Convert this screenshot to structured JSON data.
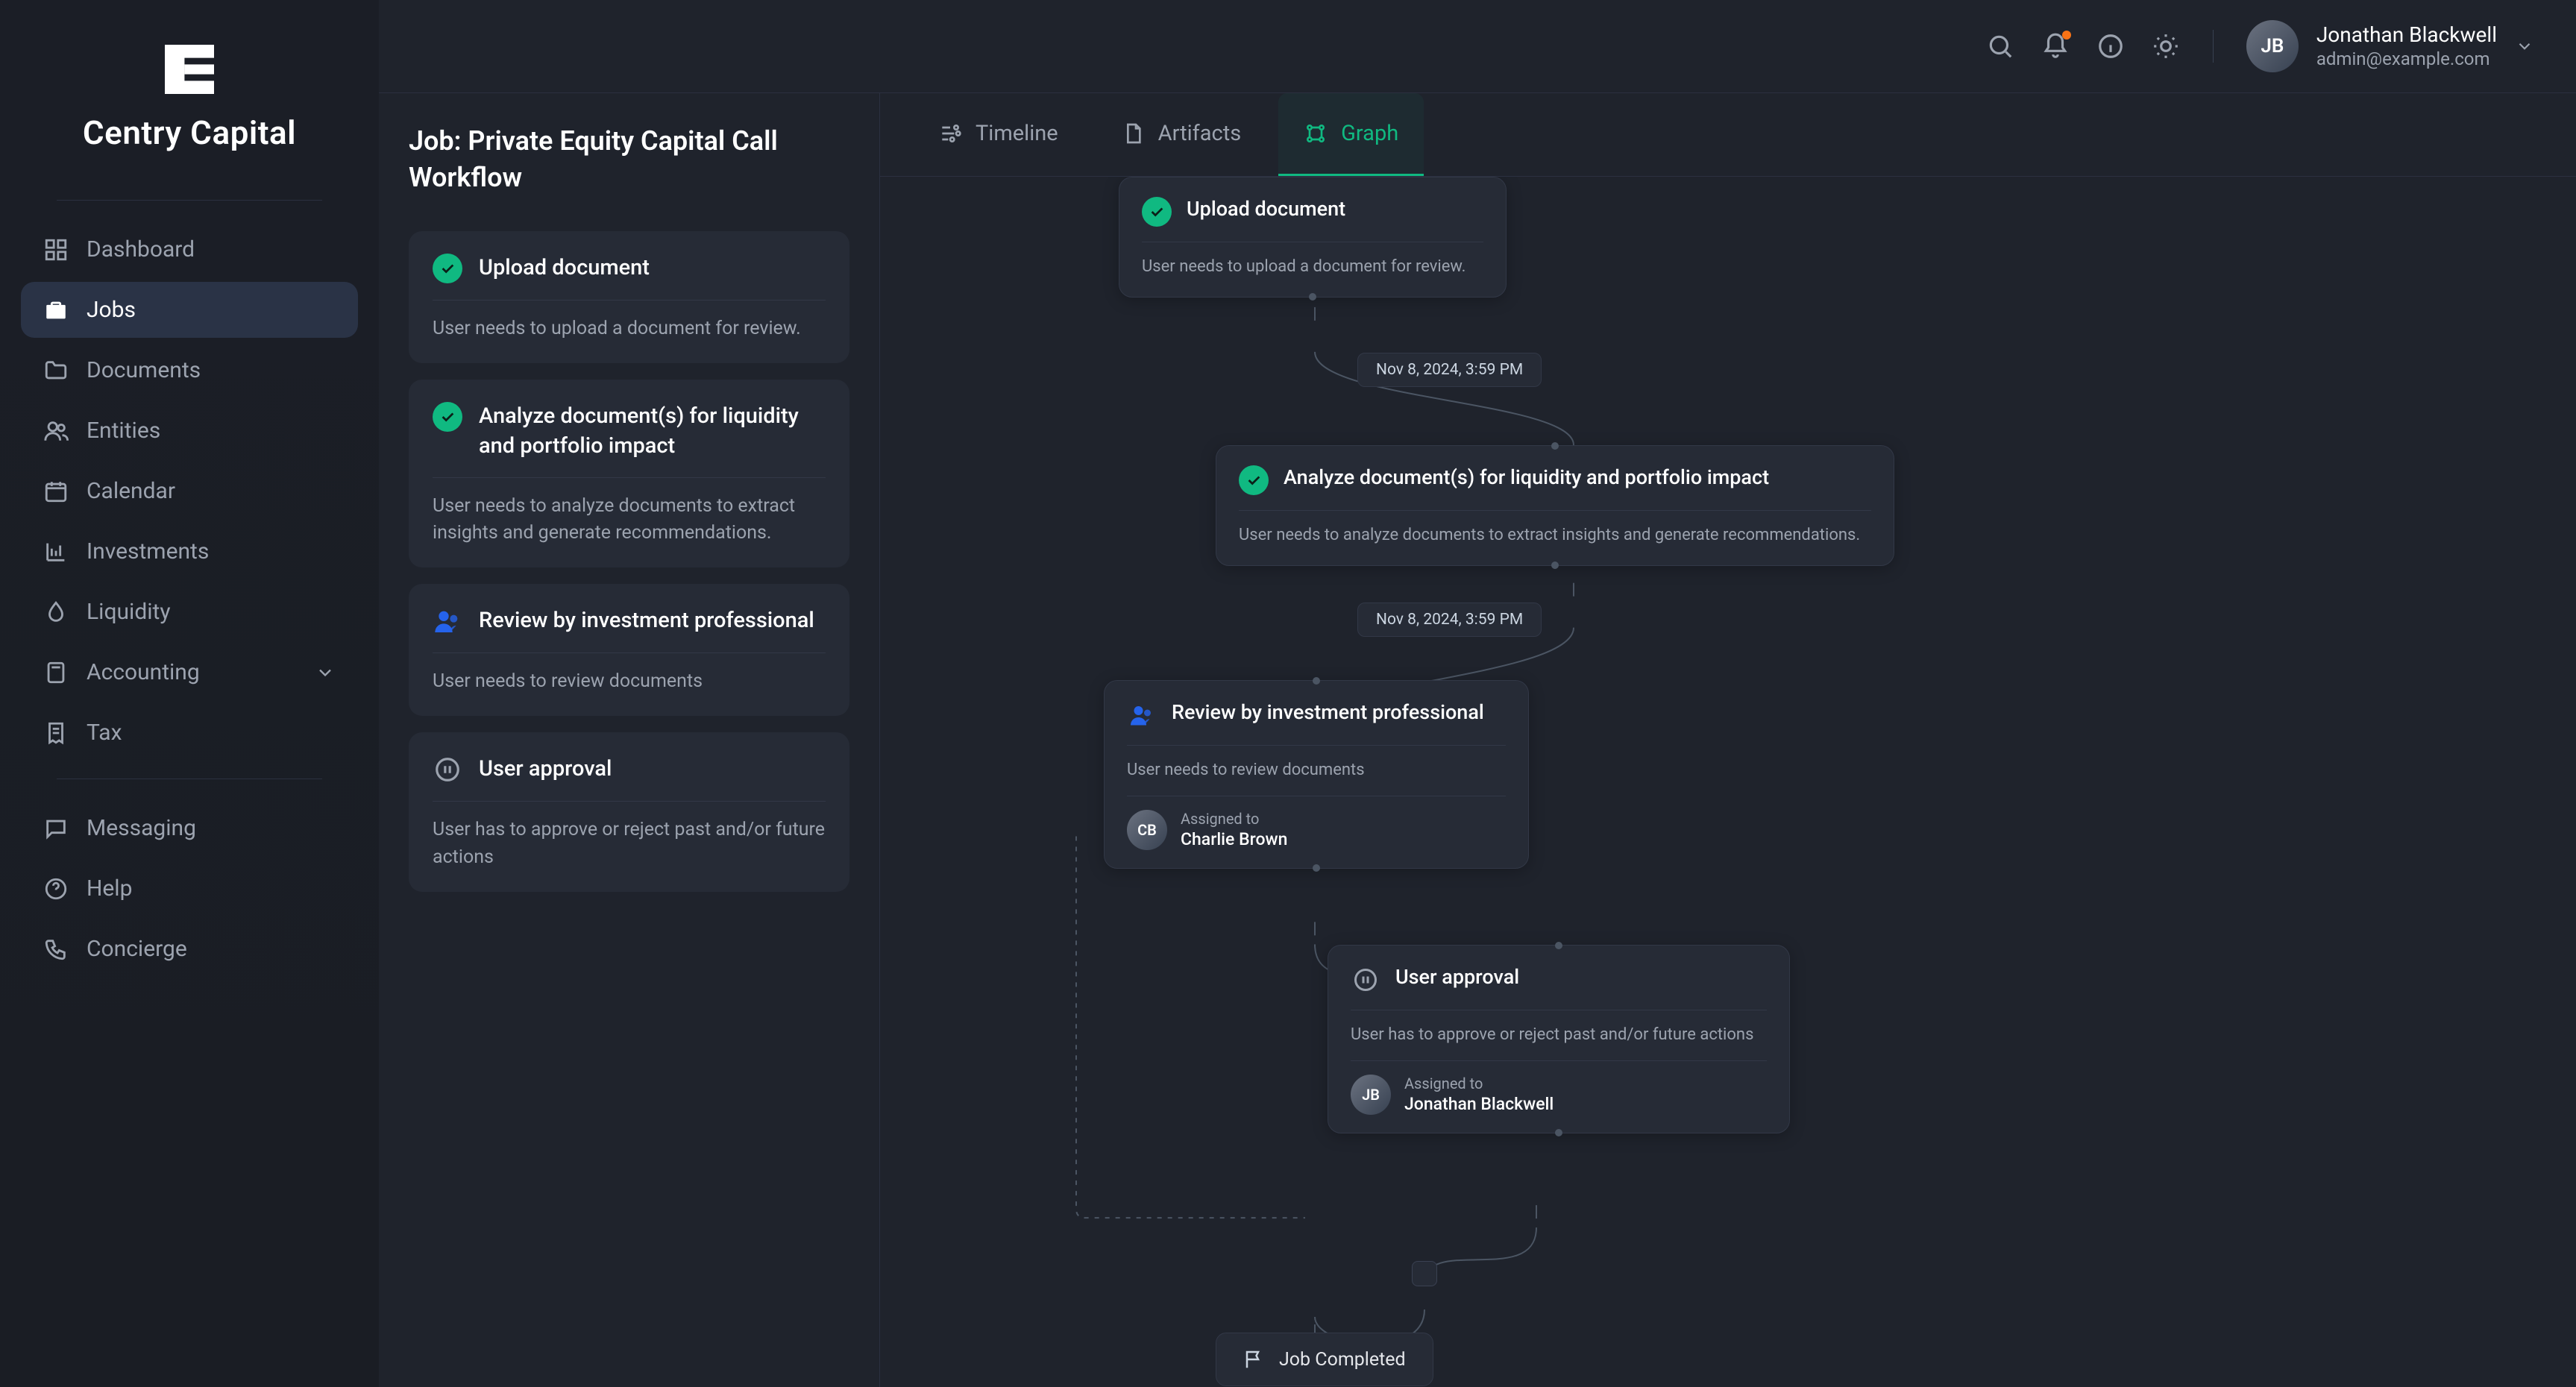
{
  "brand": {
    "name": "Centry Capital"
  },
  "user": {
    "name": "Jonathan Blackwell",
    "email": "admin@example.com",
    "initials": "JB"
  },
  "sidebar": {
    "sections": [
      {
        "items": [
          {
            "icon": "grid",
            "label": "Dashboard",
            "active": false,
            "has_children": false
          },
          {
            "icon": "briefcase",
            "label": "Jobs",
            "active": true,
            "has_children": false
          },
          {
            "icon": "folder",
            "label": "Documents",
            "active": false,
            "has_children": false
          },
          {
            "icon": "users",
            "label": "Entities",
            "active": false,
            "has_children": false
          },
          {
            "icon": "calendar",
            "label": "Calendar",
            "active": false,
            "has_children": false
          },
          {
            "icon": "chart",
            "label": "Investments",
            "active": false,
            "has_children": false
          },
          {
            "icon": "droplet",
            "label": "Liquidity",
            "active": false,
            "has_children": false
          },
          {
            "icon": "calculator",
            "label": "Accounting",
            "active": false,
            "has_children": true
          },
          {
            "icon": "receipt",
            "label": "Tax",
            "active": false,
            "has_children": false
          }
        ]
      },
      {
        "items": [
          {
            "icon": "message",
            "label": "Messaging",
            "active": false,
            "has_children": false
          },
          {
            "icon": "help",
            "label": "Help",
            "active": false,
            "has_children": false
          },
          {
            "icon": "phone",
            "label": "Concierge",
            "active": false,
            "has_children": false
          }
        ]
      }
    ]
  },
  "panel": {
    "title": "Job: Private Equity Capital Call Workflow",
    "steps": [
      {
        "status": "done",
        "title": "Upload document",
        "desc": "User needs to upload a document for review."
      },
      {
        "status": "done",
        "title": "Analyze document(s) for liquidity and portfolio impact",
        "desc": "User needs to analyze documents to extract insights and generate recommendations."
      },
      {
        "status": "user",
        "title": "Review by investment professional",
        "desc": "User needs to review documents"
      },
      {
        "status": "pause",
        "title": "User approval",
        "desc": "User has to approve or reject past and/or future actions"
      }
    ]
  },
  "canvasTabs": [
    {
      "icon": "timeline",
      "label": "Timeline",
      "active": false
    },
    {
      "icon": "artifact",
      "label": "Artifacts",
      "active": false
    },
    {
      "icon": "graph",
      "label": "Graph",
      "active": true
    }
  ],
  "graph": {
    "nodes": [
      {
        "status": "done",
        "title": "Upload document",
        "sub": "User needs to upload a document for review.",
        "assigned": null
      },
      {
        "status": "done",
        "title": "Analyze document(s) for liquidity and portfolio impact",
        "sub": "User needs to analyze documents to extract insights and generate recommendations.",
        "assigned": null
      },
      {
        "status": "user",
        "title": "Review by investment professional",
        "sub": "User needs to review documents",
        "assigned": {
          "label": "Assigned to",
          "name": "Charlie Brown",
          "initials": "CB"
        }
      },
      {
        "status": "pause",
        "title": "User approval",
        "sub": "User has to approve or reject past and/or future actions",
        "assigned": {
          "label": "Assigned to",
          "name": "Jonathan Blackwell",
          "initials": "JB"
        }
      }
    ],
    "timestamps": [
      "Nov 8, 2024, 3:59 PM",
      "Nov 8, 2024, 3:59 PM"
    ],
    "completed": "Job Completed"
  }
}
